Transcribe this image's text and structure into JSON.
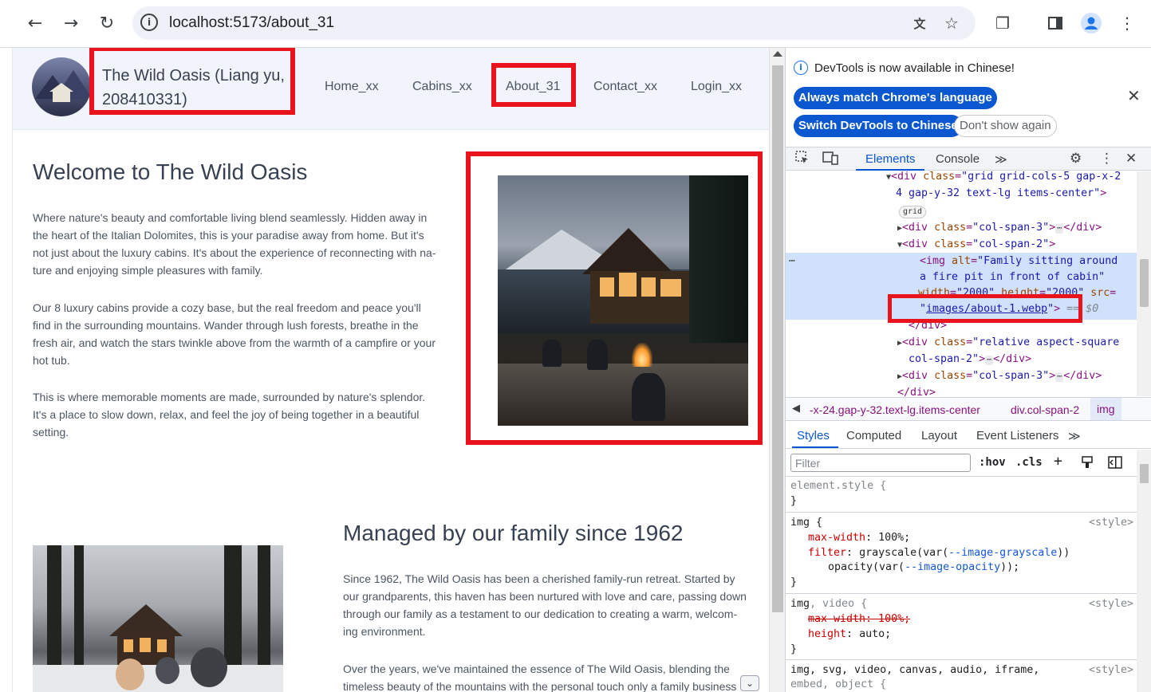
{
  "browser": {
    "url": "localhost:5173/about_31",
    "back_icon": "arrow-left-icon",
    "forward_icon": "arrow-right-icon",
    "reload_icon": "reload-icon"
  },
  "site": {
    "title": "The Wild Oasis (Liang yu, 208410331)",
    "nav": [
      "Home_xx",
      "Cabins_xx",
      "About_31",
      "Contact_xx",
      "Login_xx"
    ]
  },
  "about": {
    "heading1": "Welcome to The Wild Oasis",
    "p1": "Where nature's beauty and comfortable living blend seamlessly. Hidden away in the heart of the Italian Dolomites, this is your paradise away from home. But it's not just about the luxury cabins. It's about the experience of reconnecting with na-ture and enjoying simple pleasures with family.",
    "p2": "Our 8 luxury cabins provide a cozy base, but the real freedom and peace you'll find in the surrounding mountains. Wander through lush forests, breathe in the fresh air, and watch the stars twinkle above from the warmth of a campfire or your hot tub.",
    "p3": "This is where memorable moments are made, surrounded by nature's splendor. It's a place to slow down, relax, and feel the joy of being together in a beautiful setting.",
    "heading2": "Managed by our family since 1962",
    "p4": "Since 1962, The Wild Oasis has been a cherished family-run retreat. Started by our grandparents, this haven has been nurtured with love and care, passing down through our family as a testament to our dedication to creating a warm, welcom-ing environment.",
    "p5": "Over the years, we've maintained the essence of The Wild Oasis, blending the timeless beauty of the mountains with the personal touch only a family business"
  },
  "devtools": {
    "notice": "DevTools is now available in Chinese!",
    "btn_match": "Always match Chrome's language",
    "btn_switch": "Switch DevTools to Chinese",
    "btn_dont_show": "Don't show again",
    "tabs": [
      "Elements",
      "Console"
    ],
    "more_tabs": "≫",
    "dom": {
      "l1_tag_open": "<div",
      "l1_attr": "class",
      "l1_val": "\"grid grid-cols-5 gap-x-2",
      "l2_val": "4 gap-y-32 text-lg items-center\"",
      "badge": "grid",
      "l3_val": "\"col-span-3\"",
      "l4_val": "\"col-span-2\"",
      "l5_alt_attr": "alt",
      "l5_alt_val": "\"Family sitting around",
      "l6_alt_val": "a fire pit in front of cabin\"",
      "l7_width_attr": "width",
      "l7_width_val": "\"2000\"",
      "l7_height_attr": "height",
      "l7_height_val": "\"2000\"",
      "l7_src_attr": "src",
      "l8_src_val": "images/about-1.webp",
      "l8_eq": "== $0",
      "l9": "</div>",
      "l10_val": "\"relative aspect-square",
      "l11_val": "col-span-2\"",
      "l12_val": "\"col-span-3\"",
      "l13": "</div>"
    },
    "crumbs": [
      "-x-24.gap-y-32.text-lg.items-center",
      "div.col-span-2",
      "img"
    ],
    "style_tabs": [
      "Styles",
      "Computed",
      "Layout",
      "Event Listeners"
    ],
    "filter_placeholder": "Filter",
    "hov": ":hov",
    "cls": ".cls",
    "origin": "<style>",
    "rules": {
      "r0_sel": "element.style {",
      "r0_close": "}",
      "r1_sel": "img {",
      "r1_p1": "max-width",
      "r1_v1": "100%;",
      "r1_p2": "filter",
      "r1_v2a": "grayscale(var(",
      "r1_var1": "--image-grayscale",
      "r1_v2b": "))",
      "r1_v3a": "opacity(var(",
      "r1_var2": "--image-opacity",
      "r1_v3b": "));",
      "r1_close": "}",
      "r2_sel": "img",
      "r2_sel_b": ", video {",
      "r2_p1": "max-width: 100%;",
      "r2_p2": "height",
      "r2_v2": "auto;",
      "r2_close": "}",
      "r3_sel": "img, svg, video, canvas, audio, iframe,",
      "r3_sel2": "embed, object {"
    }
  },
  "colors": {
    "highlight_red": "#e8131b",
    "devtools_blue": "#0b57d0"
  }
}
